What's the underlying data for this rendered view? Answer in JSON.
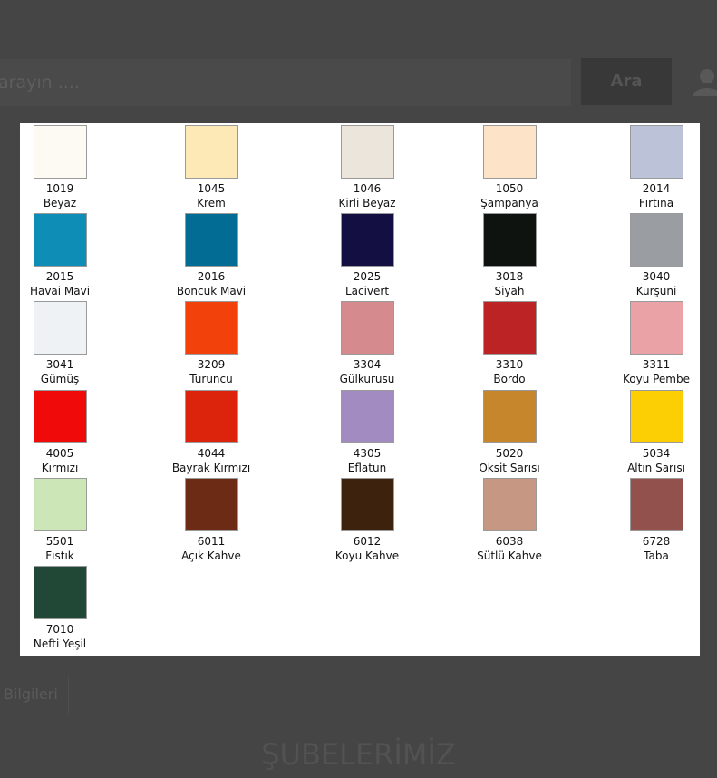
{
  "search": {
    "placeholder": "arayın ....",
    "button_label": "Ara"
  },
  "header": {
    "user_icon": "user-icon"
  },
  "background_tab": {
    "label": "Bilgileri"
  },
  "section_heading": "ŞUBELERİMİZ",
  "swatches": [
    {
      "code": "1019",
      "name": "Beyaz",
      "color": "#fcfaf3"
    },
    {
      "code": "1045",
      "name": "Krem",
      "color": "#fde9b6"
    },
    {
      "code": "1046",
      "name": "Kirli Beyaz",
      "color": "#ece5dc"
    },
    {
      "code": "1050",
      "name": "Şampanya",
      "color": "#fde3c7"
    },
    {
      "code": "2014",
      "name": "Fırtına",
      "color": "#bcc3d8"
    },
    {
      "code": "2015",
      "name": "Havai Mavi",
      "color": "#0e8db6"
    },
    {
      "code": "2016",
      "name": "Boncuk Mavi",
      "color": "#036c95"
    },
    {
      "code": "2025",
      "name": "Lacivert",
      "color": "#130f42"
    },
    {
      "code": "3018",
      "name": "Siyah",
      "color": "#0e130f"
    },
    {
      "code": "3040",
      "name": "Kurşuni",
      "color": "#9a9ea2"
    },
    {
      "code": "3041",
      "name": "Gümüş",
      "color": "#eef2f4"
    },
    {
      "code": "3209",
      "name": "Turuncu",
      "color": "#f2410a"
    },
    {
      "code": "3304",
      "name": "Gülkurusu",
      "color": "#d58a8e"
    },
    {
      "code": "3310",
      "name": "Bordo",
      "color": "#bb2324"
    },
    {
      "code": "3311",
      "name": "Koyu Pembe",
      "color": "#eba2a6"
    },
    {
      "code": "4005",
      "name": "Kırmızı",
      "color": "#f00a0a"
    },
    {
      "code": "4044",
      "name": "Bayrak Kırmızı",
      "color": "#dc240d"
    },
    {
      "code": "4305",
      "name": "Eflatun",
      "color": "#a28bc0"
    },
    {
      "code": "5020",
      "name": "Oksit Sarısı",
      "color": "#c6862c"
    },
    {
      "code": "5034",
      "name": "Altın Sarısı",
      "color": "#fccf04"
    },
    {
      "code": "5501",
      "name": "Fıstık",
      "color": "#cde6b8"
    },
    {
      "code": "6011",
      "name": "Açık Kahve",
      "color": "#6b2b15"
    },
    {
      "code": "6012",
      "name": "Koyu Kahve",
      "color": "#3d230d"
    },
    {
      "code": "6038",
      "name": "Sütlü Kahve",
      "color": "#c69884"
    },
    {
      "code": "6728",
      "name": "Taba",
      "color": "#92514c"
    },
    {
      "code": "7010",
      "name": "Nefti Yeşil",
      "color": "#214837"
    }
  ]
}
